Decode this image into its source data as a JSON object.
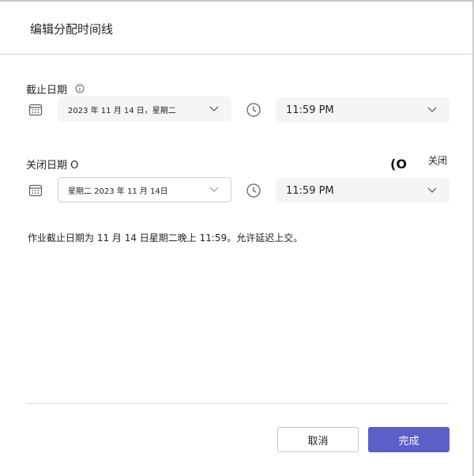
{
  "dialog": {
    "title": "编辑分配时间线"
  },
  "due": {
    "label": "截止日期",
    "date_value": "2023 年 11 月 14 日，星期二",
    "time_value": "11:59 PM"
  },
  "close": {
    "label": "关闭日期 O",
    "date_value": "星期二 2023 年 11 月 14日",
    "time_value": "11:59 PM",
    "toggle_glyph": "(O",
    "toggle_label": "关闭",
    "toggle_tilde": "~~"
  },
  "summary": "作业截止日期为 11 月 14 日星期二晚上 11:59。允许延迟上交。",
  "footer": {
    "cancel_label": "取消",
    "done_label": "完成"
  },
  "colors": {
    "primary": "#5b5fc7",
    "field_bg": "#f5f5f5",
    "text": "#242424",
    "icon": "#616161"
  },
  "icons": {
    "calendar": "calendar-icon",
    "clock": "clock-icon",
    "chevron": "chevron-down-icon",
    "info": "info-icon"
  }
}
